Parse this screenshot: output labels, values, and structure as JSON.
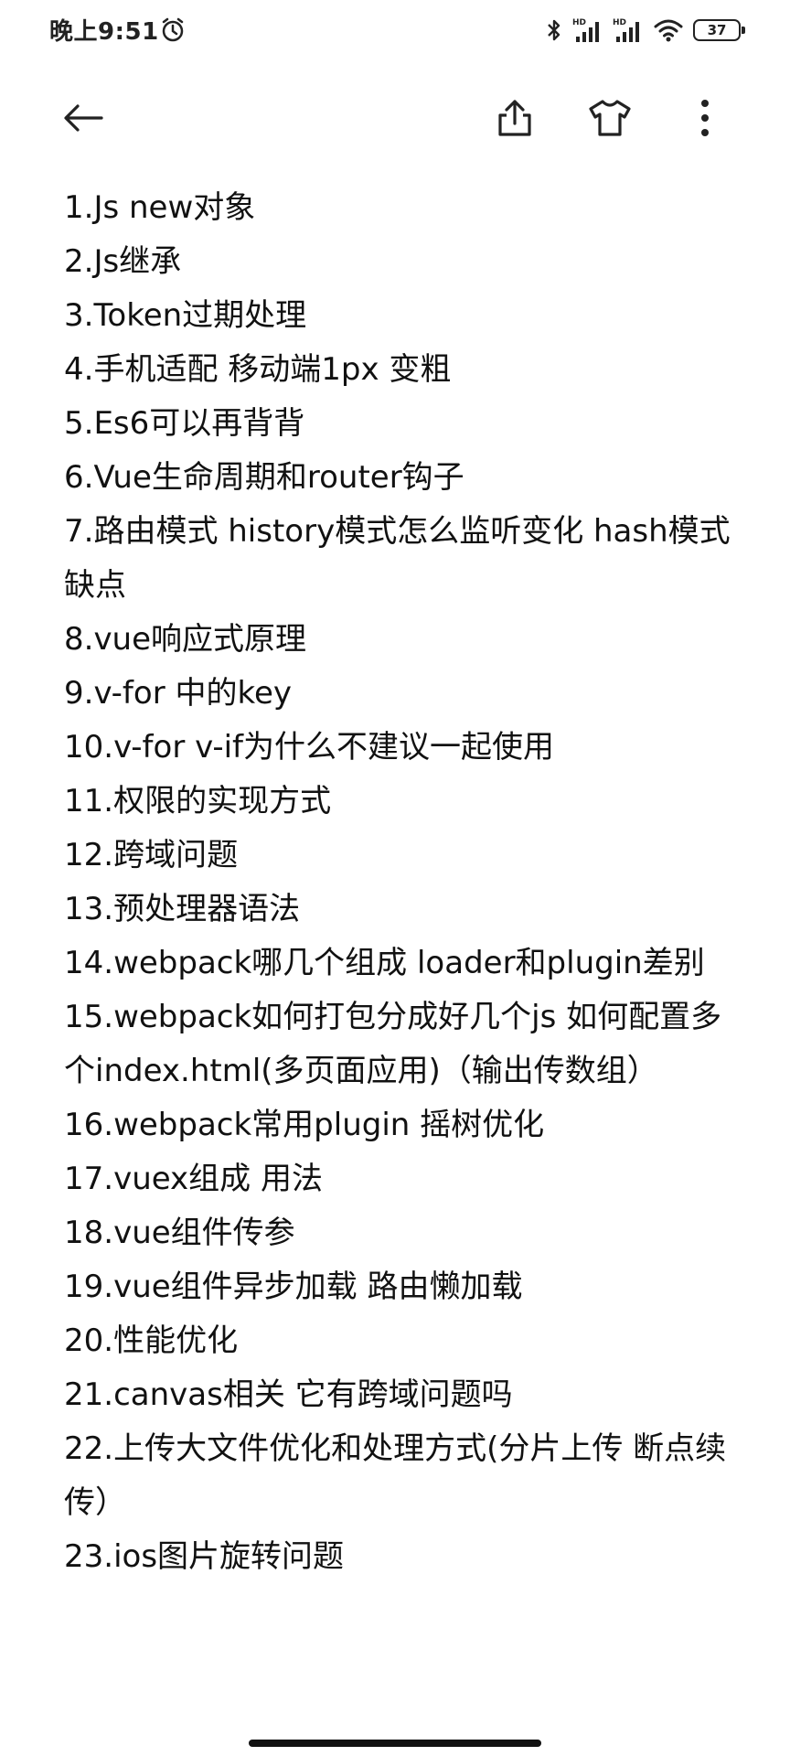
{
  "status_bar": {
    "time": "晚上9:51",
    "battery": "37",
    "icons": [
      "alarm-icon",
      "bluetooth-icon",
      "signal-hd-icon",
      "signal-hd-icon",
      "wifi-icon",
      "battery-icon"
    ]
  },
  "toolbar": {
    "icons": [
      "back-arrow-icon",
      "share-icon",
      "theme-shirt-icon",
      "more-vertical-icon"
    ]
  },
  "note": {
    "lines": [
      "1.Js new对象",
      "2.Js继承",
      "3.Token过期处理",
      "4.手机适配  移动端1px 变粗",
      "5.Es6可以再背背",
      "6.Vue生命周期和router钩子",
      "7.路由模式 history模式怎么监听变化 hash模式缺点",
      "8.vue响应式原理",
      "9.v-for 中的key",
      "10.v-for v-if为什么不建议一起使用",
      "11.权限的实现方式",
      "12.跨域问题",
      "13.预处理器语法",
      "14.webpack哪几个组成  loader和plugin差别",
      "15.webpack如何打包分成好几个js   如何配置多个index.html(多页面应用)（输出传数组）",
      "16.webpack常用plugin 摇树优化",
      "17.vuex组成  用法",
      "18.vue组件传参",
      "19.vue组件异步加载 路由懒加载",
      "20.性能优化",
      "21.canvas相关 它有跨域问题吗",
      "22.上传大文件优化和处理方式(分片上传 断点续传）",
      "23.ios图片旋转问题"
    ]
  },
  "colors": {
    "background": "#ffffff",
    "text": "#111111"
  }
}
